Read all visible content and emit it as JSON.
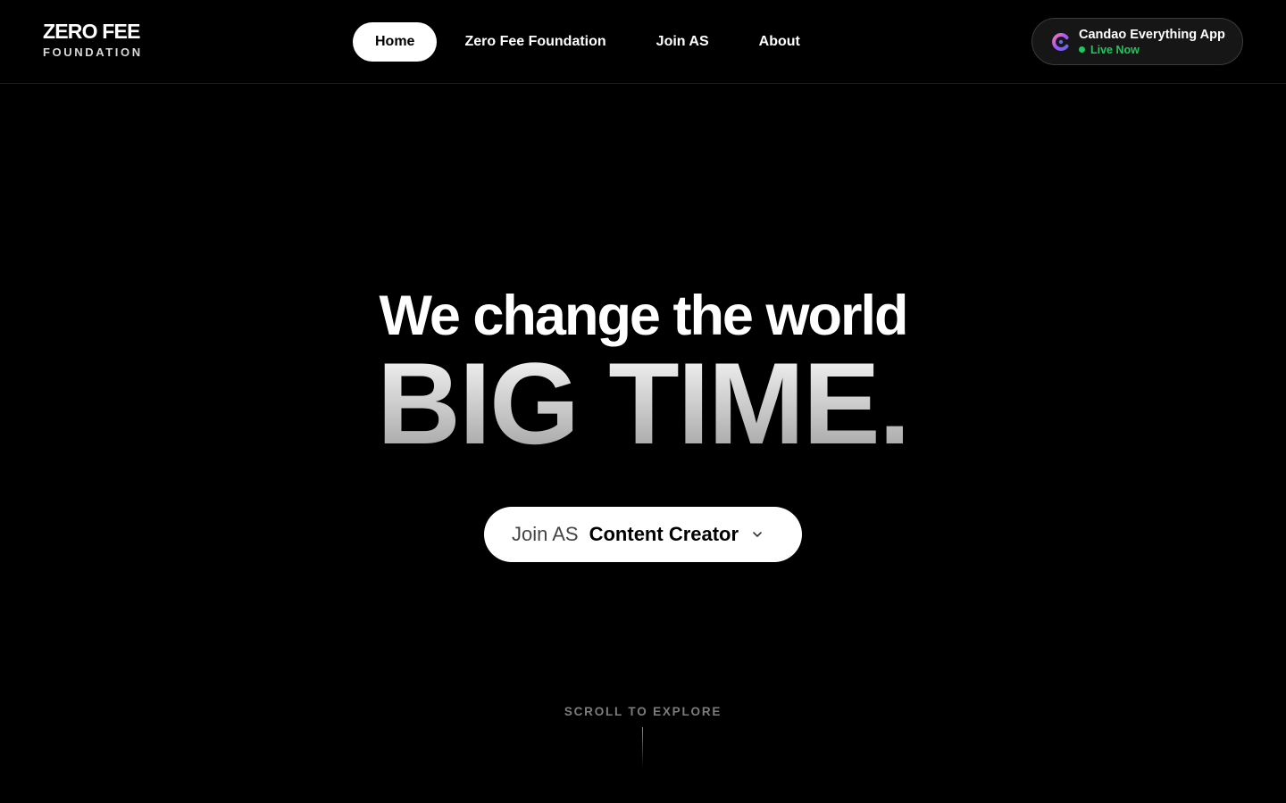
{
  "header": {
    "logo": {
      "line1": "ZERO FEE",
      "line2": "FOUNDATION"
    },
    "nav": [
      {
        "label": "Home",
        "active": true
      },
      {
        "label": "Zero Fee Foundation",
        "active": false
      },
      {
        "label": "Join AS",
        "active": false
      },
      {
        "label": "About",
        "active": false
      }
    ],
    "app_badge": {
      "icon": "candao-logo-icon",
      "name": "Candao Everything App",
      "status": "Live Now",
      "status_color": "#22c55e"
    }
  },
  "hero": {
    "line1": "We change the world",
    "line2": "BIG TIME."
  },
  "cta": {
    "prefix": "Join AS",
    "selected_role": "Content Creator",
    "icon": "chevron-down-icon"
  },
  "scroll": {
    "label": "SCROLL TO EXPLORE"
  },
  "colors": {
    "background": "#000000",
    "text": "#ffffff",
    "accent_live": "#22c55e"
  }
}
